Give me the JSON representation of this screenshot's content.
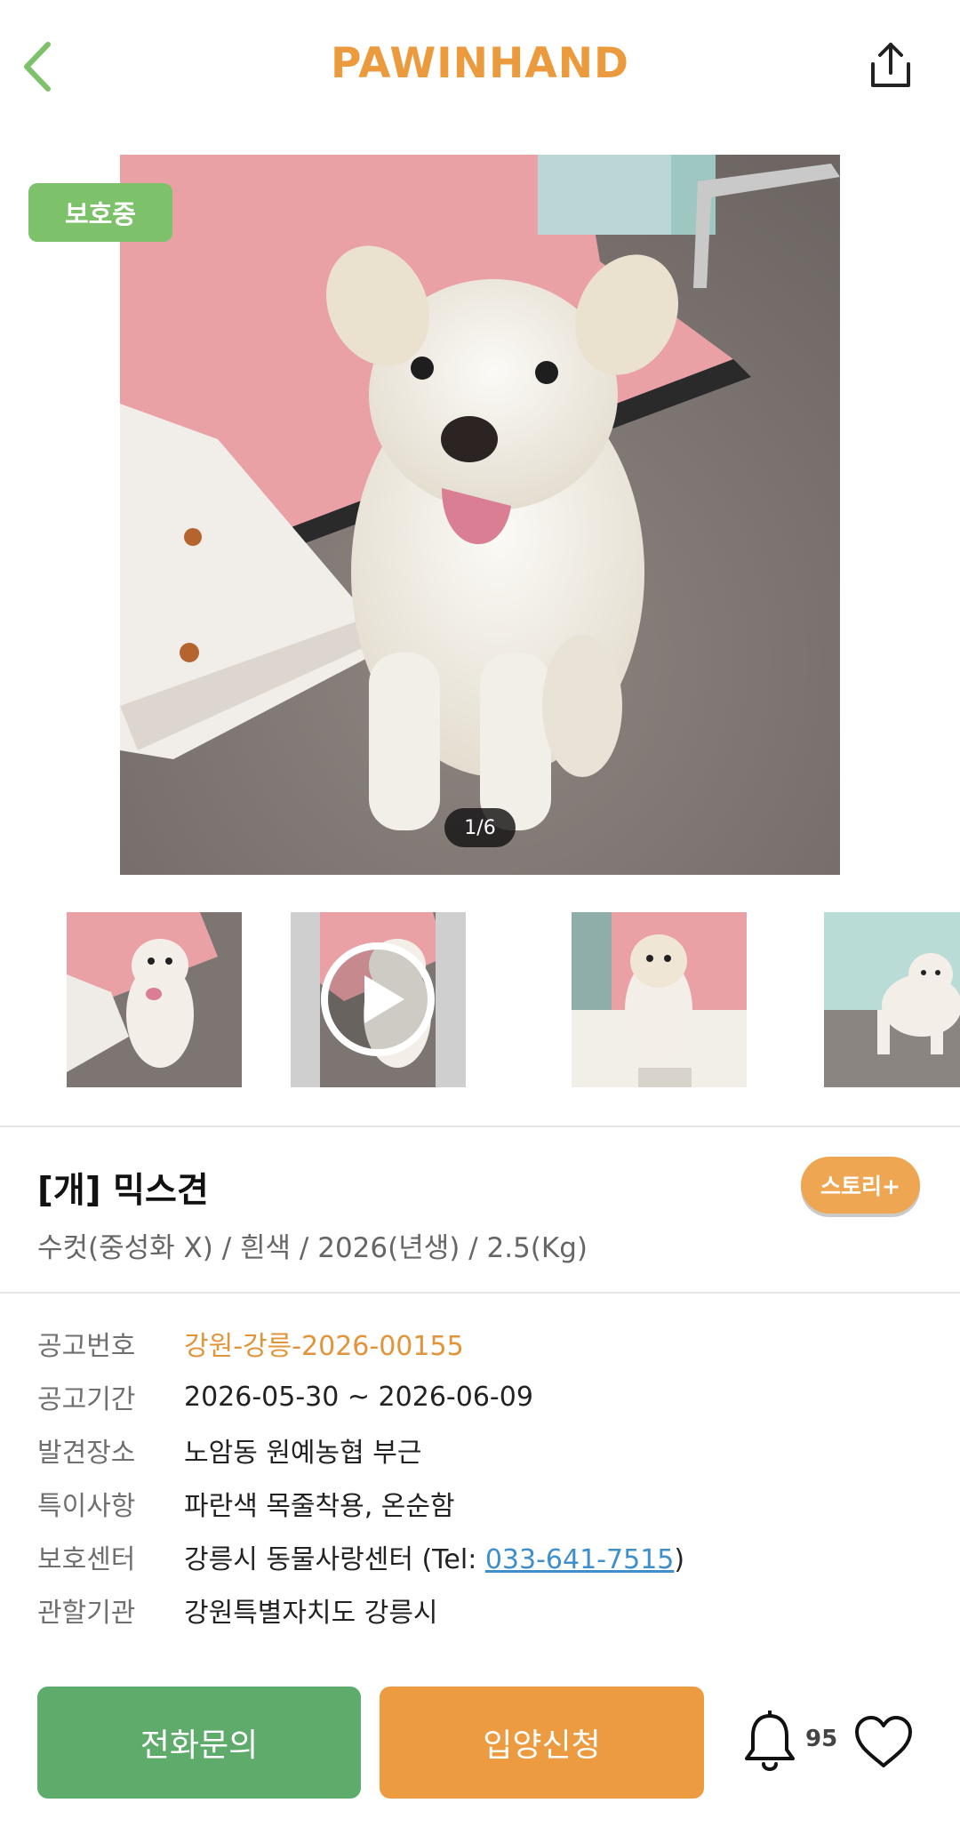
{
  "header": {
    "logo_text": "PAWINHAND",
    "back_icon": "chevron-left-icon",
    "share_icon": "share-icon",
    "logo_color": "#EC9A3E",
    "back_color": "#7DC16A"
  },
  "gallery": {
    "status_badge": "보호중",
    "counter": "1/6",
    "thumbnails": [
      "photo",
      "video",
      "photo",
      "photo"
    ]
  },
  "animal": {
    "title": "[개] 믹스견",
    "story_button": "스토리+",
    "details": "수컷(중성화 X) / 흰색 / 2026(년생) / 2.5(Kg)"
  },
  "info": {
    "rows": [
      {
        "label": "공고번호",
        "value": "강원-강릉-2026-00155"
      },
      {
        "label": "공고기간",
        "value": "2026-05-30 ~ 2026-06-09"
      },
      {
        "label": "발견장소",
        "value": "노암동 원예농협 부근"
      },
      {
        "label": "특이사항",
        "value": "파란색 목줄착용, 온순함"
      },
      {
        "label": "보호센터",
        "value": "강릉시 동물사랑센터 (Tel: ",
        "phone": "033-641-7515",
        "suffix": ")"
      },
      {
        "label": "관할기관",
        "value": "강원특별자치도 강릉시"
      }
    ]
  },
  "actions": {
    "call_button": "전화문의",
    "adopt_button": "입양신청",
    "bell_count": "95",
    "bell_icon": "bell-icon",
    "heart_icon": "heart-icon"
  },
  "colors": {
    "green_badge": "#7DC16A",
    "call_green": "#5EAB6C",
    "adopt_orange": "#EC9B40",
    "story_orange": "#EFA653",
    "link_blue": "#3E8FCB"
  }
}
